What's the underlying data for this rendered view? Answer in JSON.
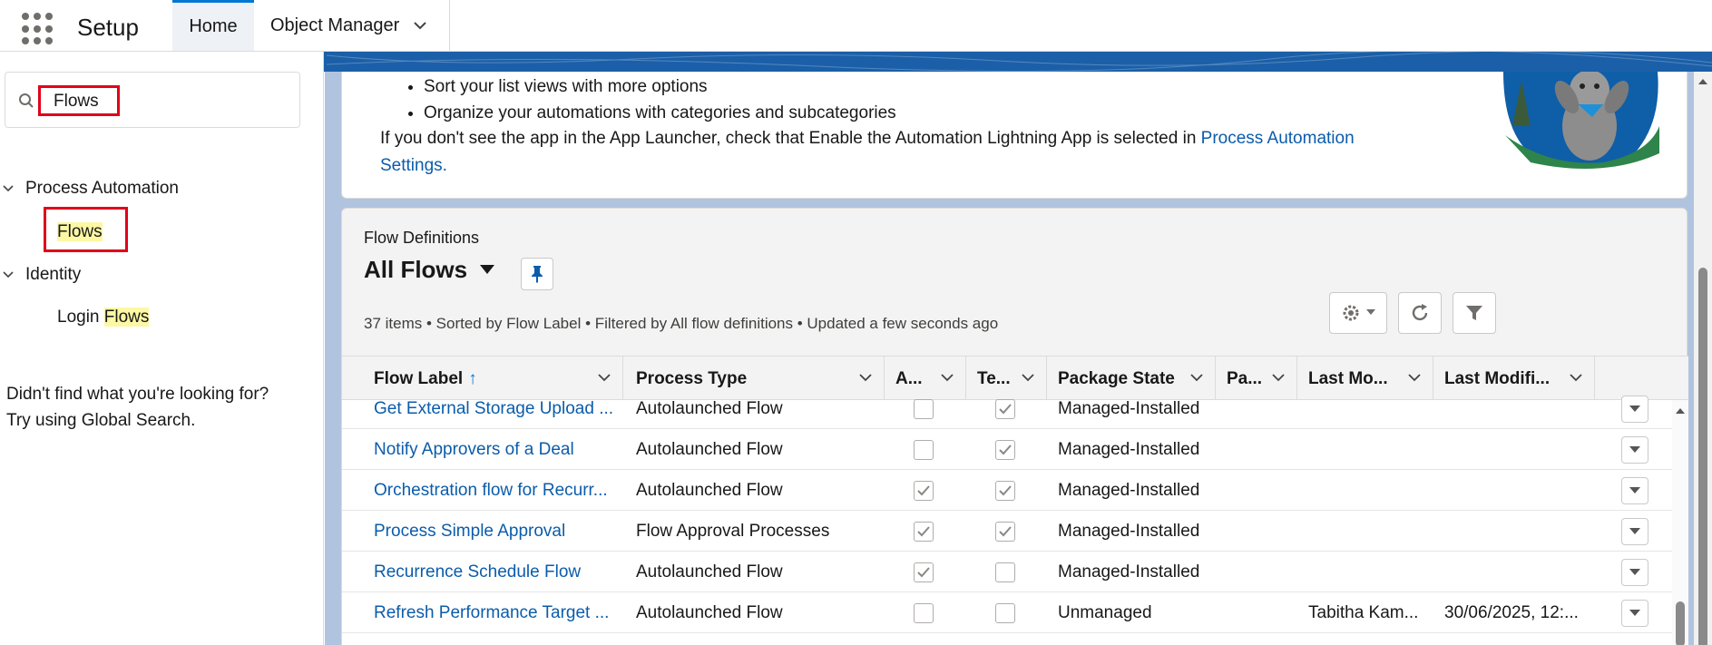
{
  "header": {
    "app_name": "Setup",
    "tabs": [
      {
        "label": "Home"
      },
      {
        "label": "Object Manager"
      }
    ]
  },
  "sidebar": {
    "search_value": "Flows",
    "groups": [
      {
        "label": "Process Automation",
        "items": [
          {
            "label_highlight": "Flows"
          }
        ]
      },
      {
        "label": "Identity",
        "items": [
          {
            "label_prefix": "Login ",
            "label_highlight": "Flows"
          }
        ]
      }
    ],
    "help_line1": "Didn't find what you're looking for?",
    "help_line2": "Try using Global Search."
  },
  "promo": {
    "bullets": [
      "Sort your list views with more options",
      "Organize your automations with categories and subcategories"
    ],
    "text": "If you don't see the app in the App Launcher, check that Enable the Automation Lightning App is selected in ",
    "link": "Process Automation Settings."
  },
  "list": {
    "object_label": "Flow Definitions",
    "title": "All Flows",
    "info": "37 items • Sorted by Flow Label • Filtered by All flow definitions • Updated a few seconds ago",
    "columns": [
      "Flow Label",
      "Process Type",
      "A...",
      "Te...",
      "Package State",
      "Pa...",
      "Last Mo...",
      "Last Modifi..."
    ],
    "rows": [
      {
        "label": "Get External Storage Upload ...",
        "type": "Autolaunched Flow",
        "active": false,
        "template": true,
        "state": "Managed-Installed",
        "pa": "",
        "last_by": "",
        "last_date": ""
      },
      {
        "label": "Notify Approvers of a Deal",
        "type": "Autolaunched Flow",
        "active": false,
        "template": true,
        "state": "Managed-Installed",
        "pa": "",
        "last_by": "",
        "last_date": ""
      },
      {
        "label": "Orchestration flow for Recurr...",
        "type": "Autolaunched Flow",
        "active": true,
        "template": true,
        "state": "Managed-Installed",
        "pa": "",
        "last_by": "",
        "last_date": ""
      },
      {
        "label": "Process Simple Approval",
        "type": "Flow Approval Processes",
        "active": true,
        "template": true,
        "state": "Managed-Installed",
        "pa": "",
        "last_by": "",
        "last_date": ""
      },
      {
        "label": "Recurrence Schedule Flow",
        "type": "Autolaunched Flow",
        "active": true,
        "template": false,
        "state": "Managed-Installed",
        "pa": "",
        "last_by": "",
        "last_date": ""
      },
      {
        "label": "Refresh Performance Target ...",
        "type": "Autolaunched Flow",
        "active": false,
        "template": false,
        "state": "Unmanaged",
        "pa": "",
        "last_by": "Tabitha Kam...",
        "last_date": "30/06/2025, 12:..."
      }
    ]
  },
  "colors": {
    "link": "#0b5cab",
    "accent": "#0176d3",
    "highlight": "#fcf8a3",
    "annotation_box": "#e0001b",
    "band": "#1b5fa8"
  }
}
